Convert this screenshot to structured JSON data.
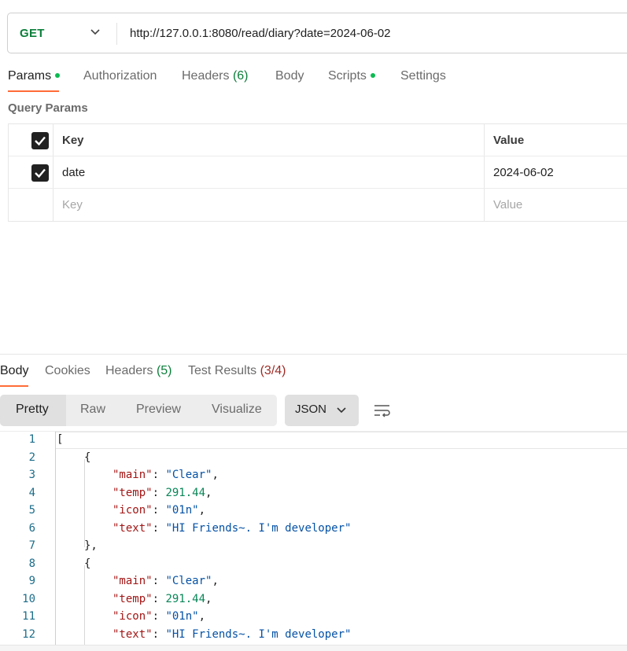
{
  "request": {
    "method": "GET",
    "url": "http://127.0.0.1:8080/read/diary?date=2024-06-02"
  },
  "request_tabs": [
    {
      "label": "Params",
      "dot": true,
      "active": true
    },
    {
      "label": "Authorization"
    },
    {
      "label": "Headers",
      "count": "(6)"
    },
    {
      "label": "Body"
    },
    {
      "label": "Scripts",
      "dot": true
    },
    {
      "label": "Settings"
    }
  ],
  "query_params": {
    "title": "Query Params",
    "header": {
      "key": "Key",
      "value": "Value"
    },
    "rows": [
      {
        "key": "date",
        "value": "2024-06-02",
        "checked": true
      }
    ],
    "placeholder": {
      "key": "Key",
      "value": "Value"
    }
  },
  "response_tabs": [
    {
      "label": "Body",
      "active": true
    },
    {
      "label": "Cookies"
    },
    {
      "label": "Headers",
      "count": "(5)"
    },
    {
      "label": "Test Results",
      "count": "(3/4)"
    }
  ],
  "view_modes": [
    "Pretty",
    "Raw",
    "Preview",
    "Visualize"
  ],
  "active_view_mode": "Pretty",
  "format": "JSON",
  "icons": {
    "method_dropdown": "chevron-down-icon",
    "format_dropdown": "chevron-down-icon",
    "wrap": "wrap-lines-icon",
    "checkbox": "check-icon"
  },
  "colors": {
    "method_get": "#0b7f3a",
    "accent": "#ff6c37",
    "dot": "#0cbb52",
    "json_key": "#a31515",
    "json_string": "#0451a5",
    "json_number": "#098658",
    "line_number": "#1d6d8a"
  },
  "code_lines": [
    {
      "n": "1",
      "text": "["
    },
    {
      "n": "2",
      "text": "{"
    },
    {
      "n": "3",
      "key": "\"main\"",
      "val": "\"Clear\"",
      "tail": ","
    },
    {
      "n": "4",
      "key": "\"temp\"",
      "num": "291.44",
      "tail": ","
    },
    {
      "n": "5",
      "key": "\"icon\"",
      "val": "\"01n\"",
      "tail": ","
    },
    {
      "n": "6",
      "key": "\"text\"",
      "val": "\"HI Friends~. I'm developer\"",
      "tail": ""
    },
    {
      "n": "7",
      "text": "},"
    },
    {
      "n": "8",
      "text": "{"
    },
    {
      "n": "9",
      "key": "\"main\"",
      "val": "\"Clear\"",
      "tail": ","
    },
    {
      "n": "10",
      "key": "\"temp\"",
      "num": "291.44",
      "tail": ","
    },
    {
      "n": "11",
      "key": "\"icon\"",
      "val": "\"01n\"",
      "tail": ","
    },
    {
      "n": "12",
      "key": "\"text\"",
      "val": "\"HI Friends~. I'm developer\"",
      "tail": ""
    }
  ]
}
